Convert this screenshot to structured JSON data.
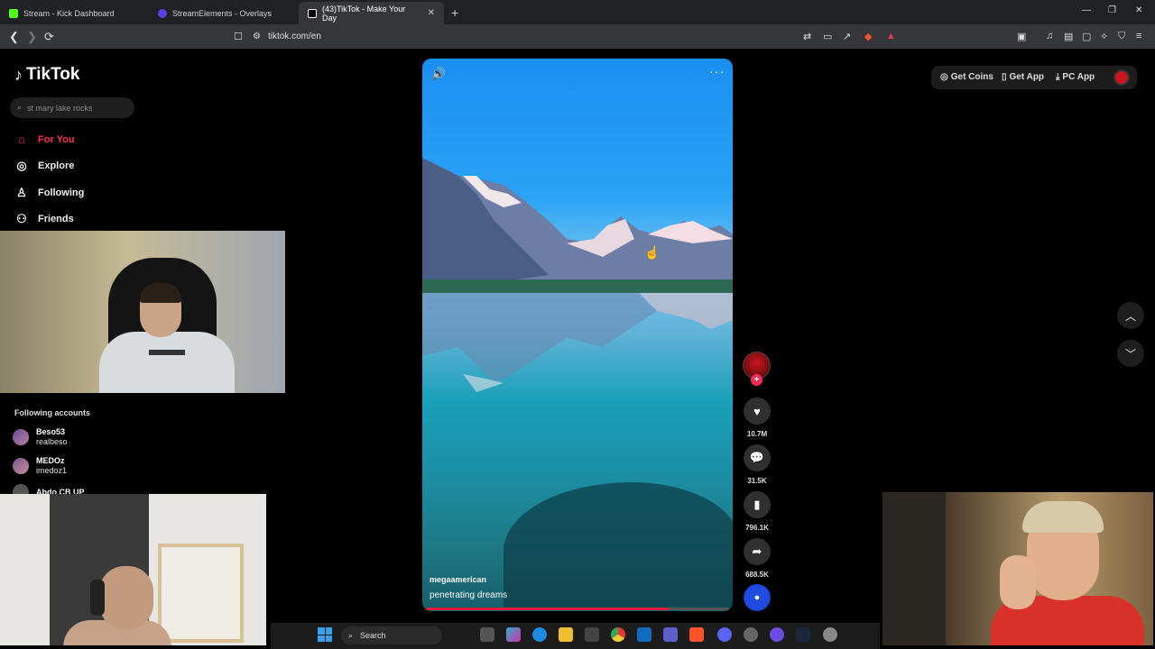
{
  "browser": {
    "tabs": [
      {
        "label": "Stream - Kick Dashboard",
        "color": "#53fc18"
      },
      {
        "label": "StreamElements - Overlays",
        "color": "#5c3ee8"
      },
      {
        "label": "(43)TikTok - Make Your Day",
        "color": "#ffffff"
      }
    ],
    "url": "tiktok.com/en",
    "new_tab": "+",
    "tab_close": "✕",
    "window": {
      "minimize": "—",
      "maximize": "❐",
      "close": "✕"
    },
    "nav": {
      "back": "❮",
      "forward": "❯",
      "reload": "⟳"
    }
  },
  "sidebar": {
    "logo": "TikTok",
    "search_placeholder": "st mary lake rocks",
    "nav": [
      {
        "label": "For You",
        "icon": "home-icon",
        "glyph": "⌂",
        "active": true
      },
      {
        "label": "Explore",
        "icon": "compass-icon",
        "glyph": "◎",
        "active": false
      },
      {
        "label": "Following",
        "icon": "following-icon",
        "glyph": "♙",
        "active": false
      },
      {
        "label": "Friends",
        "icon": "friends-icon",
        "glyph": "⚇",
        "active": false
      }
    ],
    "following_title": "Following accounts",
    "accounts": [
      {
        "name": "Beso53",
        "username": "realbeso"
      },
      {
        "name": "MEDOz",
        "username": "imedoz1"
      },
      {
        "name": "Abdo CB UP",
        "username": ""
      }
    ]
  },
  "video": {
    "author": "megaamerican",
    "description": "penetrating dreams",
    "progress": 0.8,
    "sound_icon": "🔊",
    "more_icon": "···"
  },
  "actions": {
    "likes": "10.7M",
    "comments": "31.5K",
    "saves": "796.1K",
    "shares": "688.5K",
    "follow_plus": "+"
  },
  "topbar": {
    "get_coins": "Get Coins",
    "get_app": "Get App",
    "pc_app": "PC App"
  },
  "taskbar": {
    "search_label": "Search"
  },
  "colors": {
    "accent": "#fe2c55",
    "progress": "#e01b3c"
  }
}
